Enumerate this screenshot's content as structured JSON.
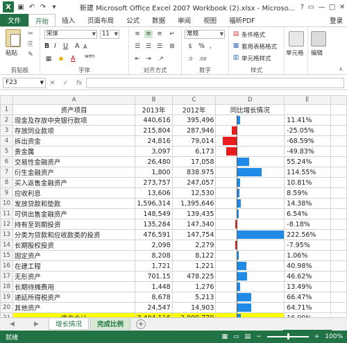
{
  "window": {
    "title": "新建 Microsoft Office Excel 2007 Workbook (2).xlsx - Microso...",
    "controls": [
      "?",
      "▭",
      "—",
      "□",
      "✕"
    ]
  },
  "ribbon_tabs": [
    "文件",
    "开始",
    "插入",
    "页面布局",
    "公式",
    "数据",
    "审阅",
    "视图",
    "福昕PDF"
  ],
  "login": "登录",
  "ribbon": {
    "clipboard": {
      "paste": "粘贴",
      "label": "剪贴板"
    },
    "font": {
      "name": "宋体",
      "size": "11",
      "grow": "A",
      "shrink": "A",
      "bold": "B",
      "italic": "I",
      "underline": "U",
      "wen": "wén",
      "label": "字体"
    },
    "alignment": {
      "label": "对齐方式"
    },
    "number": {
      "format": "常规",
      "percent": "%",
      "comma": ",",
      "label": "数字"
    },
    "styles": {
      "conditional": "条件格式",
      "table": "套用表格格式",
      "cell": "单元格样式",
      "label": "样式"
    },
    "cells": {
      "label": "单元格"
    },
    "editing": {
      "label": "编辑"
    }
  },
  "formula_bar": {
    "name_box": "F23",
    "value": ""
  },
  "columns": [
    "A",
    "B",
    "C",
    "D",
    "E"
  ],
  "header_row": [
    "资产项目",
    "2013年",
    "2012年",
    "同比增长情况",
    ""
  ],
  "rows": [
    {
      "r": "2",
      "item": "现金及存放中央银行款项",
      "y2013": "440,616",
      "y2012": "395,496",
      "pct": "11.41%",
      "growth": 11.41
    },
    {
      "r": "3",
      "item": "存放同业款项",
      "y2013": "215,804",
      "y2012": "287,946",
      "pct": "-25.05%",
      "growth": -25.05
    },
    {
      "r": "4",
      "item": "拆出资金",
      "y2013": "24,816",
      "y2012": "79,014",
      "pct": "-68.59%",
      "growth": -68.59
    },
    {
      "r": "5",
      "item": "贵金属",
      "y2013": "3,097",
      "y2012": "6,173",
      "pct": "-49.83%",
      "growth": -49.83
    },
    {
      "r": "6",
      "item": "交易性金融资产",
      "y2013": "26,480",
      "y2012": "17,058",
      "pct": "55.24%",
      "growth": 55.24
    },
    {
      "r": "7",
      "item": "衍生金融资产",
      "y2013": "1,800",
      "y2012": "838.975",
      "pct": "114.55%",
      "growth": 114.55
    },
    {
      "r": "8",
      "item": "买入返售金融资产",
      "y2013": "273,757",
      "y2012": "247,057",
      "pct": "10.81%",
      "growth": 10.81
    },
    {
      "r": "9",
      "item": "应收利息",
      "y2013": "13,606",
      "y2012": "12,530",
      "pct": "8.59%",
      "growth": 8.59
    },
    {
      "r": "10",
      "item": "发放贷款和垫款",
      "y2013": "1,596,314",
      "y2012": "1,395,646",
      "pct": "14.38%",
      "growth": 14.38
    },
    {
      "r": "11",
      "item": "可供出售金融资产",
      "y2013": "148,549",
      "y2012": "139,435",
      "pct": "6.54%",
      "growth": 6.54
    },
    {
      "r": "12",
      "item": "持有至到期投资",
      "y2013": "135,284",
      "y2012": "147,340",
      "pct": "-8.18%",
      "growth": -8.18
    },
    {
      "r": "13",
      "item": "分类为贷款和应收款类的投资",
      "y2013": "476,591",
      "y2012": "147,754",
      "pct": "222.56%",
      "growth": 222.56
    },
    {
      "r": "14",
      "item": "长期股权投资",
      "y2013": "2,098",
      "y2012": "2,279",
      "pct": "-7.95%",
      "growth": -7.95
    },
    {
      "r": "15",
      "item": "固定资产",
      "y2013": "8,208",
      "y2012": "8,122",
      "pct": "1.06%",
      "growth": 1.06
    },
    {
      "r": "16",
      "item": "在建工程",
      "y2013": "1,721",
      "y2012": "1,221",
      "pct": "40.98%",
      "growth": 40.98
    },
    {
      "r": "17",
      "item": "无形资产",
      "y2013": "701.15",
      "y2012": "478.225",
      "pct": "46.62%",
      "growth": 46.62
    },
    {
      "r": "18",
      "item": "长期待摊费用",
      "y2013": "1,448",
      "y2012": "1,276",
      "pct": "13.49%",
      "growth": 13.49
    },
    {
      "r": "19",
      "item": "递延所得税资产",
      "y2013": "8,678",
      "y2012": "5,213",
      "pct": "66.47%",
      "growth": 66.47
    },
    {
      "r": "20",
      "item": "其他资产",
      "y2013": "24,547",
      "y2012": "14,903",
      "pct": "64.71%",
      "growth": 64.71
    }
  ],
  "total_row": {
    "r": "21",
    "item": "资产合计",
    "y2013": "3,404,116",
    "y2012": "2,909,779",
    "pct": "16.99%",
    "growth": 16.99
  },
  "empty_rows": [
    "22",
    "23"
  ],
  "sheet_tabs": [
    "增长情况",
    "完成比例"
  ],
  "active_sheet": "完成比例",
  "status": {
    "ready": "就绪",
    "zoom": "100%"
  },
  "colors": {
    "positive_bar": "#1f8be6",
    "negative_bar": "#e81c1c",
    "total_fill": "#ffff00",
    "excel_green": "#217346"
  }
}
